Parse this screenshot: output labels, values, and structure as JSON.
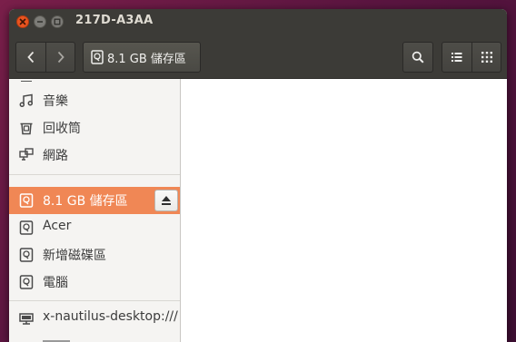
{
  "window": {
    "title": "217D-A3AA"
  },
  "toolbar": {
    "path_label": "8.1 GB 儲存區",
    "back_icon": "chevron-left-icon",
    "forward_icon": "chevron-right-icon",
    "search_icon": "search-icon",
    "list_view_icon": "list-view-icon",
    "grid_view_icon": "grid-view-icon"
  },
  "sidebar": {
    "items": [
      {
        "label": "音樂",
        "icon": "music-icon"
      },
      {
        "label": "回收筒",
        "icon": "trash-icon"
      },
      {
        "label": "網路",
        "icon": "network-icon"
      },
      {
        "label": "8.1 GB 儲存區",
        "icon": "drive-icon",
        "selected": true
      },
      {
        "label": "Acer",
        "icon": "drive-icon"
      },
      {
        "label": "新增磁碟區",
        "icon": "drive-icon"
      },
      {
        "label": "電腦",
        "icon": "drive-icon"
      },
      {
        "label": "x-nautilus-desktop:///",
        "icon": "desktop-icon"
      }
    ]
  },
  "colors": {
    "selected": "#f08755",
    "titlebar": "#3c3b37",
    "close": "#e95420"
  }
}
